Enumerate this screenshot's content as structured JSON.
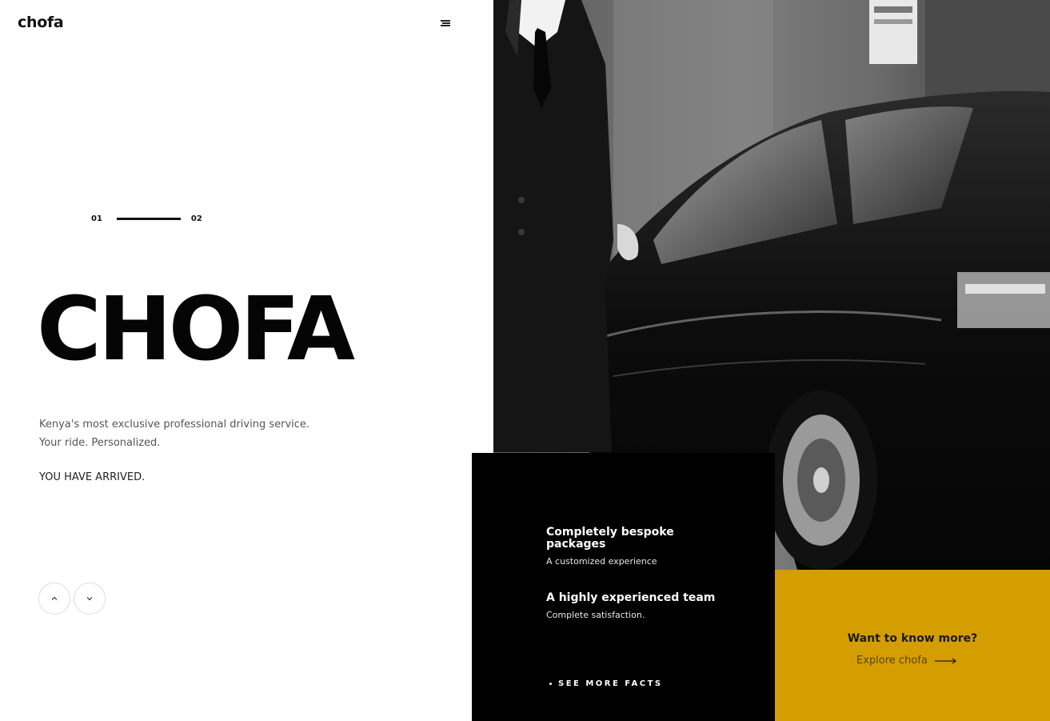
{
  "header": {
    "logo": "chofa",
    "menu_icon": "hamburger-menu-icon"
  },
  "slider": {
    "current": "01",
    "total": "02",
    "progress": 0.5
  },
  "hero": {
    "title": "CHOFA",
    "tagline_line1": "Kenya's most exclusive professional driving service.",
    "tagline_line2": "Your ride. Personalized.",
    "arrived": "YOU HAVE ARRIVED."
  },
  "controls": {
    "up_icon": "chevron-up-icon",
    "down_icon": "chevron-down-icon"
  },
  "photo": {
    "description_icon": "chauffeur-car-photo"
  },
  "facts": {
    "items": [
      {
        "title": "Completely bespoke packages",
        "subtitle": "A customized experience"
      },
      {
        "title": "A highly experienced team",
        "subtitle": "Complete satisfaction."
      }
    ],
    "see_more": "SEE MORE FACTS"
  },
  "cta": {
    "title": "Want to know more?",
    "link": "Explore chofa"
  },
  "colors": {
    "accent": "#d59e00",
    "dark": "#000000",
    "text": "#111111"
  }
}
